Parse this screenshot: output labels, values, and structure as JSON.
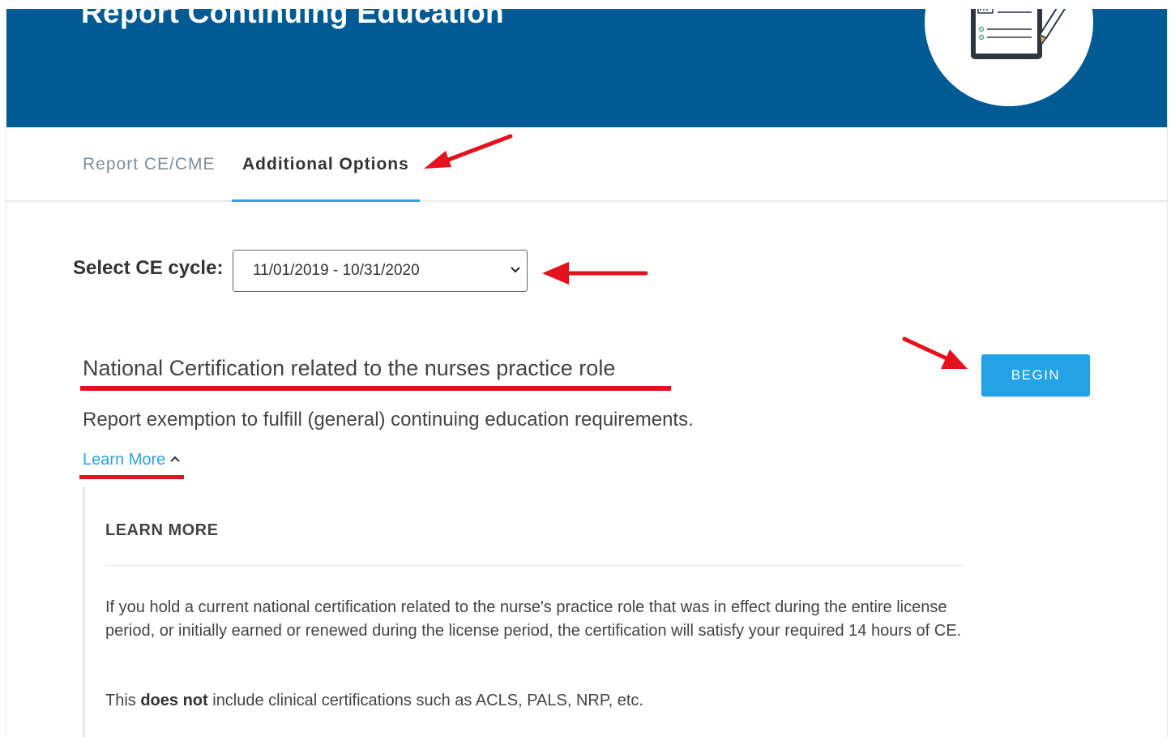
{
  "header": {
    "title": "Report Continuing Education"
  },
  "tabs": [
    {
      "label": "Report CE/CME"
    },
    {
      "label": "Additional Options"
    }
  ],
  "cycle": {
    "label": "Select CE cycle:",
    "value": "11/01/2019 - 10/31/2020"
  },
  "option": {
    "title": "National Certification related to the nurses practice role",
    "description": "Report exemption to fulfill (general) continuing education requirements.",
    "learn_more_link": "Learn More",
    "begin_label": "BEGIN"
  },
  "learn_more": {
    "heading": "LEARN MORE",
    "body": "If you hold a current national certification related to the nurse's practice role that was in effect during the entire license period, or initially earned or renewed during the license period, the certification will satisfy your required 14 hours of CE.",
    "note_prefix": "This ",
    "note_bold": "does not",
    "note_suffix": " include clinical certifications such as ACLS, PALS, NRP, etc."
  },
  "colors": {
    "banner": "#005b94",
    "accent": "#24a2e8",
    "annotation": "#e3121d"
  }
}
